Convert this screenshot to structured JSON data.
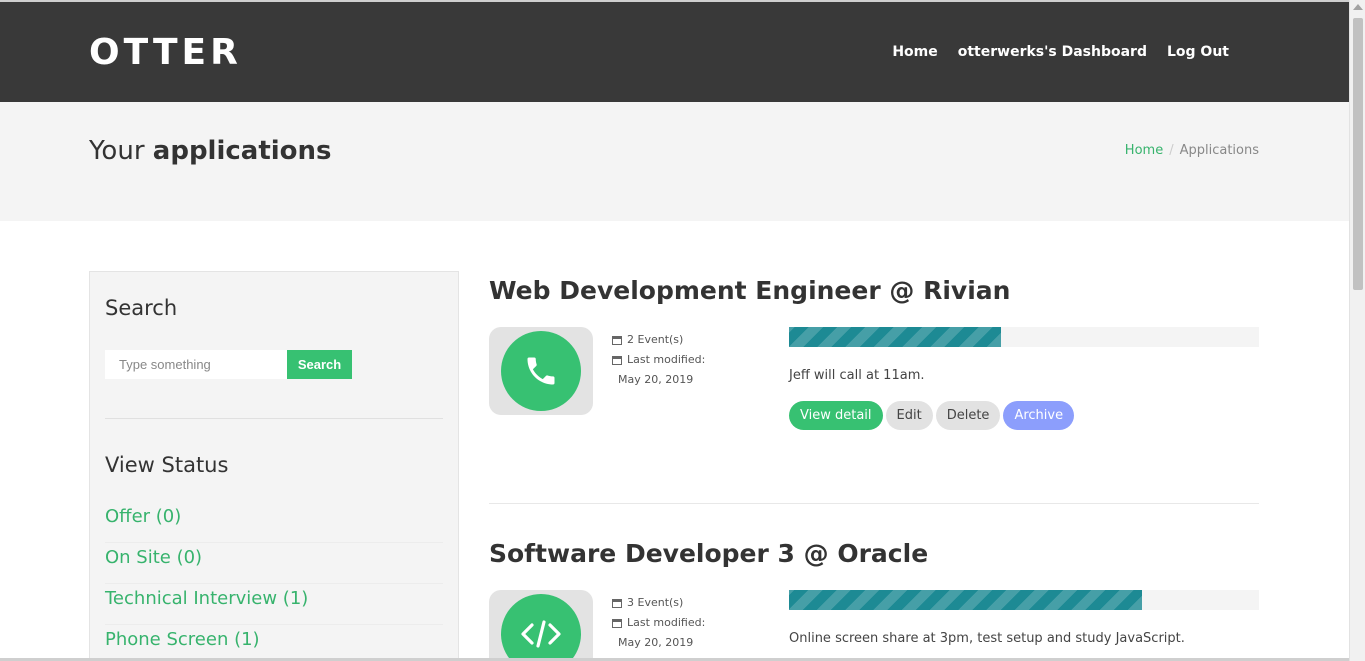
{
  "nav": {
    "brand": "OTTER",
    "links": [
      "Home",
      "otterwerks's Dashboard",
      "Log Out"
    ]
  },
  "page": {
    "title_light": "Your ",
    "title_bold": "applications",
    "breadcrumb": {
      "home": "Home",
      "sep": "/",
      "current": "Applications"
    }
  },
  "sidebar": {
    "search_heading": "Search",
    "search_placeholder": "Type something",
    "search_button": "Search",
    "status_heading": "View Status",
    "status_items": [
      "Offer (0)",
      "On Site (0)",
      "Technical Interview (1)",
      "Phone Screen (1)"
    ]
  },
  "applications": [
    {
      "title": "Web Development Engineer @ Rivian",
      "icon": "phone-icon",
      "events": "2 Event(s)",
      "modified_label": "Last modified:",
      "modified_date": "May 20, 2019",
      "progress_percent": 45,
      "note": "Jeff will call at 11am.",
      "buttons": {
        "view": "View detail",
        "edit": "Edit",
        "delete": "Delete",
        "archive": "Archive"
      }
    },
    {
      "title": "Software Developer 3 @ Oracle",
      "icon": "code-icon",
      "events": "3 Event(s)",
      "modified_label": "Last modified:",
      "modified_date": "May 20, 2019",
      "progress_percent": 75,
      "note": "Online screen share at 3pm, test setup and study JavaScript."
    }
  ],
  "colors": {
    "navbar": "#393939",
    "accent_green": "#37c172",
    "progress_teal": "#1d8a94",
    "archive_blue": "#8c9efc"
  }
}
